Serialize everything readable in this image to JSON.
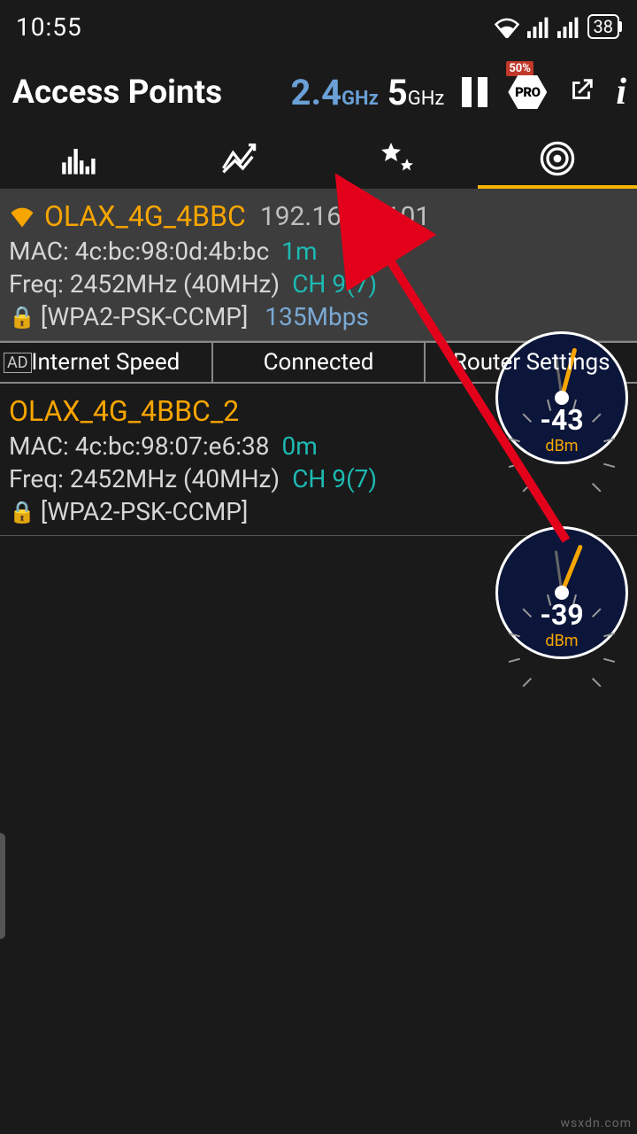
{
  "status": {
    "time": "10:55",
    "battery": "38"
  },
  "header": {
    "title": "Access Points",
    "band_24_num": "2.4",
    "band_24_unit": "GHz",
    "band_5_num": "5",
    "band_5_unit": "GHz",
    "pro_discount": "50%",
    "pro_label": "PRO"
  },
  "adbar": {
    "tag": "AD",
    "c1": "Internet Speed",
    "c2": "Connected",
    "c3": "Router Settings"
  },
  "aps": [
    {
      "ssid": "OLAX_4G_4BBC",
      "ip": "192.168.0.101",
      "mac_label": "MAC:",
      "mac": "4c:bc:98:0d:4b:bc",
      "dist": "1m",
      "freq_label": "Freq:",
      "freq": "2452MHz  (40MHz)",
      "chan": "CH 9(7)",
      "sec": "[WPA2-PSK-CCMP]",
      "rate": "135Mbps",
      "gauge_val": "-43",
      "gauge_unit": "dBm"
    },
    {
      "ssid": "OLAX_4G_4BBC_2",
      "ip": "",
      "mac_label": "MAC:",
      "mac": "4c:bc:98:07:e6:38",
      "dist": "0m",
      "freq_label": "Freq:",
      "freq": "2452MHz  (40MHz)",
      "chan": "CH 9(7)",
      "sec": "[WPA2-PSK-CCMP]",
      "rate": "",
      "gauge_val": "-39",
      "gauge_unit": "dBm"
    }
  ],
  "watermark": "wsxdn.com"
}
